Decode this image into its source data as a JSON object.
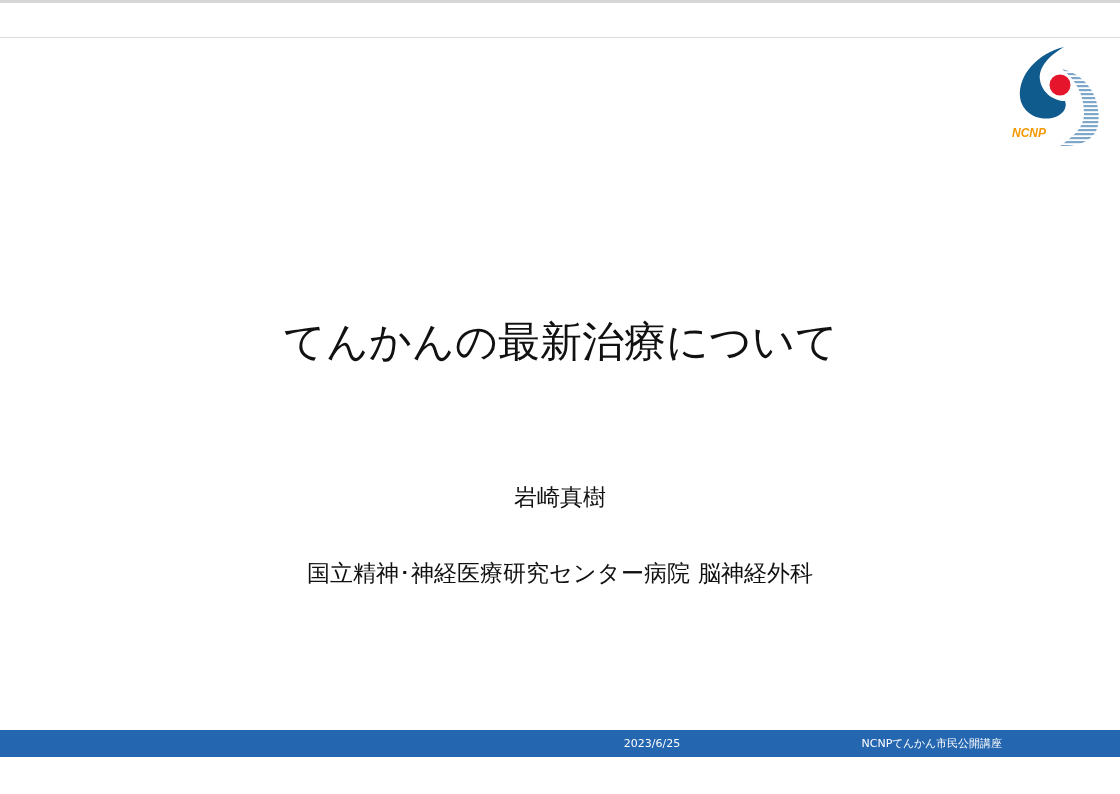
{
  "slide": {
    "logo_text": "NCNP",
    "title": "てんかんの最新治療について",
    "presenter": "岩崎真樹",
    "affiliation": "国立精神･神経医療研究センター病院 脳神経外科"
  },
  "footer": {
    "date": "2023/6/25",
    "event": "NCNPてんかん市民公開講座"
  }
}
